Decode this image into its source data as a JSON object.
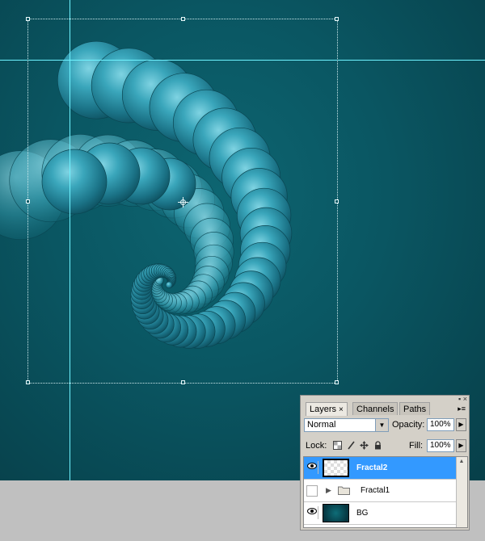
{
  "panel": {
    "tabs": [
      {
        "label": "Layers",
        "close": "×",
        "active": true
      },
      {
        "label": "Channels",
        "active": false
      },
      {
        "label": "Paths",
        "active": false
      }
    ],
    "title_buttons": "▪ ×",
    "menu_button": "▸≡",
    "blend_mode": "Normal",
    "opacity_label": "Opacity:",
    "opacity_value": "100%",
    "lock_label": "Lock:",
    "fill_label": "Fill:",
    "fill_value": "100%",
    "layers": [
      {
        "name": "Fractal2",
        "visible": true,
        "selected": true,
        "thumb": "checker"
      },
      {
        "name": "Fractal1",
        "visible": false,
        "selected": false,
        "thumb": "folder"
      },
      {
        "name": "BG",
        "visible": true,
        "selected": false,
        "thumb": "bg"
      }
    ]
  },
  "canvas": {
    "guide_color": "#6ff3ff",
    "bg_color": "#0a5662",
    "sphere_color": "#2a93a8"
  },
  "icons": {
    "eye": "eye-icon",
    "folder": "folder-icon",
    "expand": "triangle-right-icon",
    "lock_transparent": "lock-transparent-icon",
    "lock_brush": "brush-icon",
    "lock_move": "move-icon",
    "lock_all": "padlock-icon",
    "dropdown": "chevron-down-icon",
    "spinner": "triangle-right-icon"
  }
}
